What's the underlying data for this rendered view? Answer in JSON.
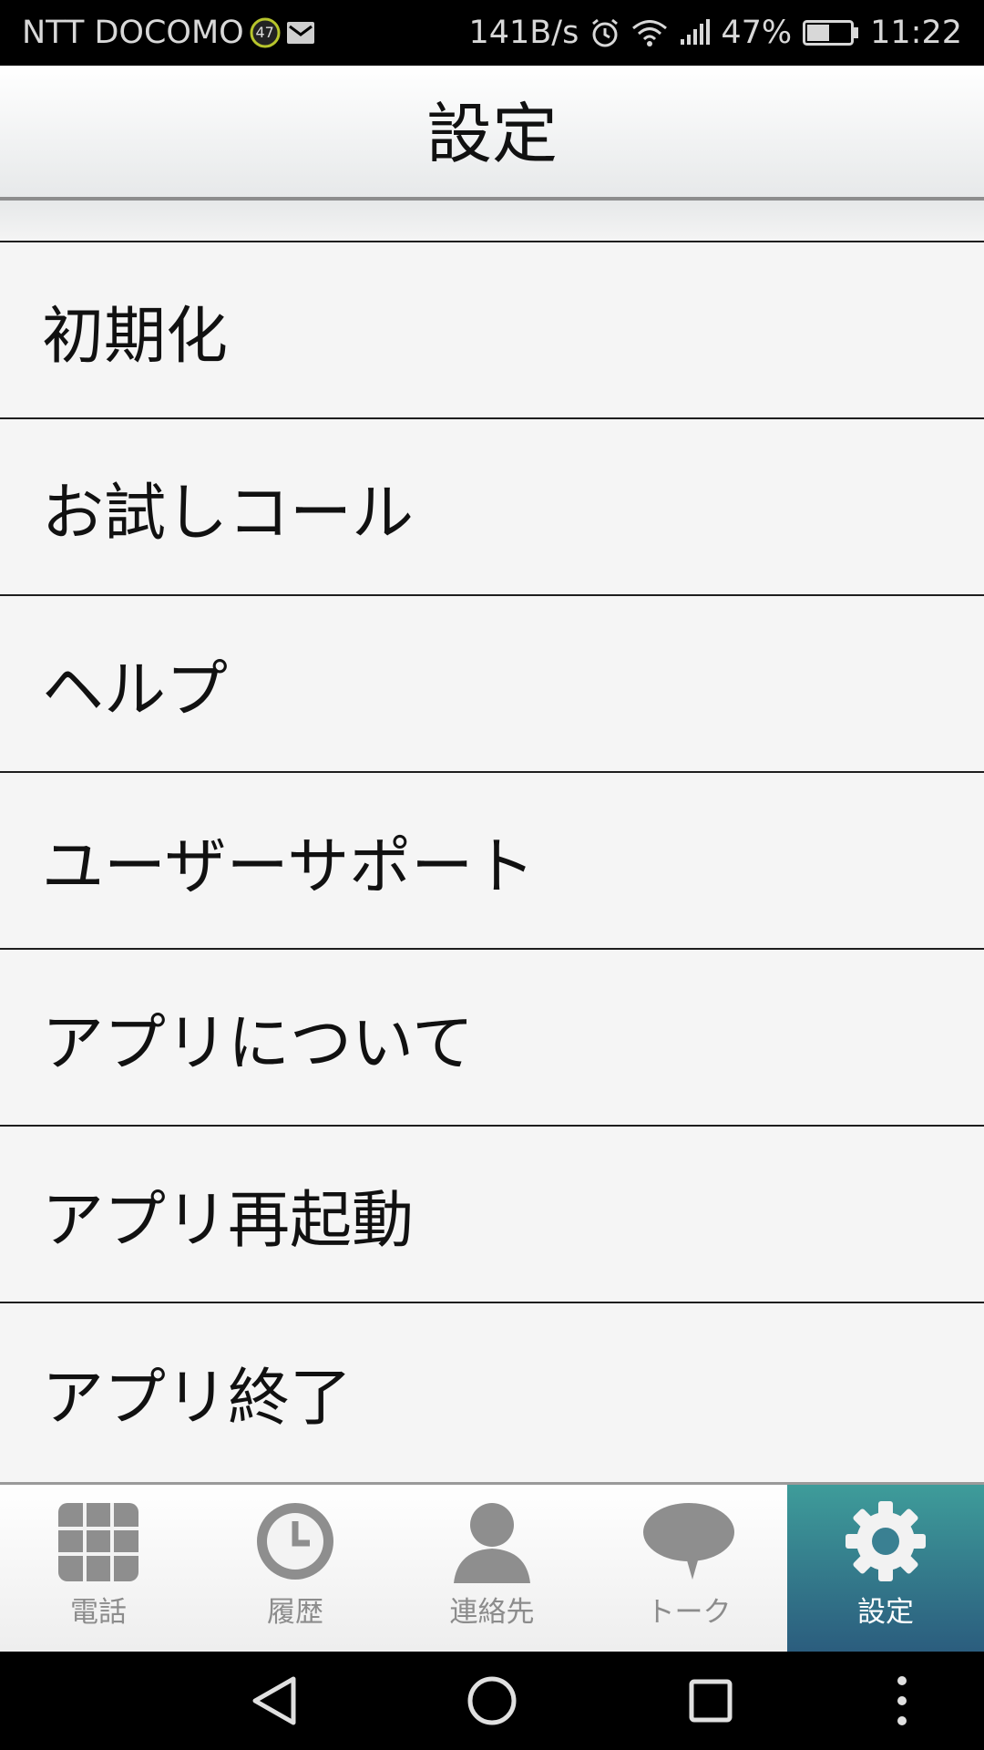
{
  "status_bar": {
    "carrier": "NTT DOCOMO",
    "notification_count": "47",
    "network_speed": "141B/s",
    "battery_percent": "47%",
    "time": "11:22"
  },
  "header": {
    "title": "設定"
  },
  "menu": {
    "items": [
      {
        "label": "初期化"
      },
      {
        "label": "お試しコール"
      },
      {
        "label": "ヘルプ"
      },
      {
        "label": "ユーザーサポート"
      },
      {
        "label": "アプリについて"
      },
      {
        "label": "アプリ再起動"
      },
      {
        "label": "アプリ終了"
      }
    ]
  },
  "tab_bar": {
    "tabs": [
      {
        "label": "電話",
        "icon": "dialpad-icon"
      },
      {
        "label": "履歴",
        "icon": "clock-icon"
      },
      {
        "label": "連絡先",
        "icon": "person-icon"
      },
      {
        "label": "トーク",
        "icon": "chat-bubble-icon"
      },
      {
        "label": "設定",
        "icon": "gear-icon",
        "active": true
      }
    ],
    "active_color": "#2e6f84"
  },
  "nav_bar": {
    "buttons": [
      "back-icon",
      "home-icon",
      "recents-icon",
      "more-icon"
    ]
  }
}
